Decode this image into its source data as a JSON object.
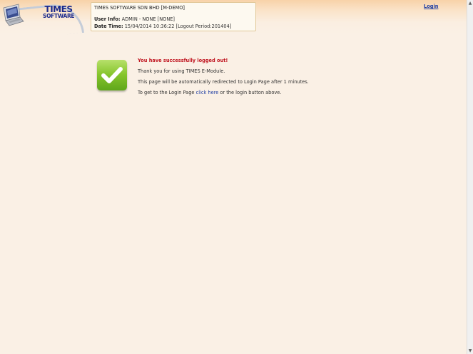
{
  "logo": {
    "line1": "TIMES",
    "line2": "SOFTWARE"
  },
  "info": {
    "company": "TIMES SOFTWARE SDN BHD [M-DEMO]",
    "user_label": "User Info:",
    "user_value": "ADMIN - NONE [NONE]",
    "date_label": "Date Time:",
    "date_value": "15/04/2014 10:36:22 [Logout Period:201404]"
  },
  "header": {
    "login_link": "Login"
  },
  "message": {
    "title": "You have successfully logged out!",
    "thanks": "Thank you for using TIMES E-Module.",
    "redirect": "This page will be automatically redirected to Login Page after 1 minutes.",
    "goto_prefix": "To get to the Login Page",
    "click_here": "click here",
    "goto_suffix": "or the login button above."
  },
  "icons": {
    "logo": "laptop-logo-icon",
    "success": "checkmark-icon",
    "scroll_up": "scroll-up-icon",
    "scroll_down": "scroll-down-icon"
  },
  "colors": {
    "title_red": "#c0141f",
    "link_blue": "#1f3ea3",
    "brand_navy": "#1b2a8c",
    "success_green": "#86c52c"
  }
}
